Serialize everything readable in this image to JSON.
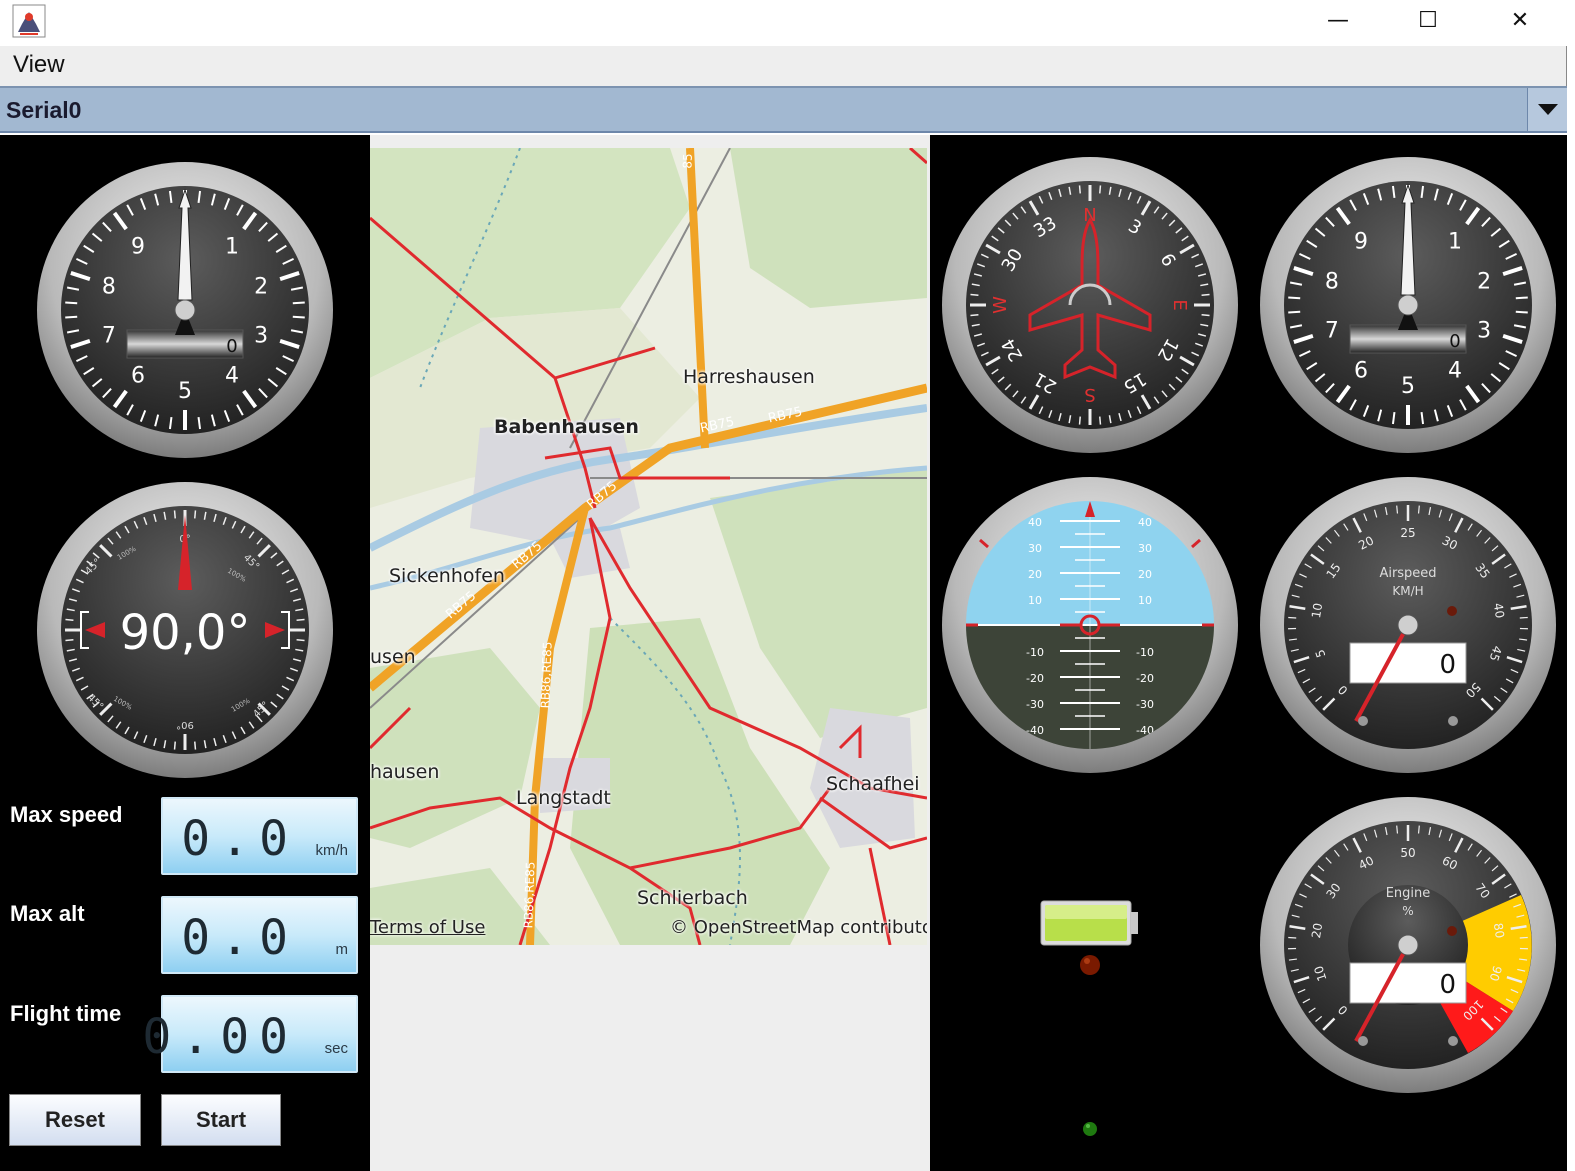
{
  "window": {
    "minimize_glyph": "—",
    "maximize_glyph": "☐",
    "close_glyph": "✕"
  },
  "menu": {
    "view_label": "View"
  },
  "port_selector": {
    "selected": "Serial0"
  },
  "gauges": {
    "altimeter_left": {
      "digits": [
        "0",
        "1",
        "2",
        "3",
        "4",
        "5",
        "6",
        "7",
        "8",
        "9"
      ],
      "counter": "0"
    },
    "altimeter_right": {
      "digits": [
        "0",
        "1",
        "2",
        "3",
        "4",
        "5",
        "6",
        "7",
        "8",
        "9"
      ],
      "counter": "0"
    },
    "heading": {
      "value_text": "90,0°",
      "top_tick": "0°",
      "bottom_tick": "90°",
      "small_labels": [
        "45°",
        "45°",
        "45°",
        "45°"
      ],
      "small_labels_pct": [
        "100%",
        "100%",
        "100%",
        "100%"
      ]
    },
    "compass": {
      "labels": [
        "N",
        "3",
        "6",
        "E",
        "12",
        "15",
        "S",
        "21",
        "24",
        "W",
        "30",
        "33"
      ],
      "accent_color": "#e03030"
    },
    "attitude": {
      "pitch_labels_up": [
        "40",
        "30",
        "20",
        "10"
      ],
      "pitch_labels_down": [
        "-10",
        "-20",
        "-30",
        "-40"
      ],
      "sky_color": "#8fd3ef",
      "ground_color": "#3d4438"
    },
    "airspeed": {
      "title": "Airspeed",
      "unit": "KM/H",
      "scale": [
        "0",
        "5",
        "10",
        "15",
        "20",
        "25",
        "30",
        "35",
        "40",
        "45",
        "50"
      ],
      "value": "0"
    },
    "engine": {
      "title": "Engine",
      "unit": "%",
      "scale": [
        "0",
        "10",
        "20",
        "30",
        "40",
        "50",
        "60",
        "70",
        "80",
        "90",
        "100"
      ],
      "value": "0",
      "warn_color": "#ffcc00",
      "danger_color": "#ff1a1a"
    }
  },
  "stats": {
    "max_speed": {
      "label": "Max speed",
      "value": "0.0",
      "unit": "km/h"
    },
    "max_alt": {
      "label": "Max alt",
      "value": "0.0",
      "unit": "m"
    },
    "flight_time": {
      "label": "Flight time",
      "value": "0.00",
      "unit": "sec"
    }
  },
  "buttons": {
    "reset": "Reset",
    "start": "Start"
  },
  "map": {
    "towns": {
      "harreshausen": "Harreshausen",
      "babenhausen": "Babenhausen",
      "sickenhofen": "Sickenhofen",
      "usen": "usen",
      "hausen": "hausen",
      "langstadt": "Langstadt",
      "schaafhei": "Schaafhei",
      "schlierbach": "Schlierbach"
    },
    "road_labels": {
      "rb75_a": "RB75",
      "rb75_b": "RB75",
      "rb75_c": "RB75",
      "rb75_d": "RB75",
      "rb75_e": "RB75",
      "rb86_a": "RB86,RE85",
      "rb86_b": "RB86,RE85",
      "re85": "85"
    },
    "terms": "Terms of Use",
    "attribution": "© OpenStreetMap contributors"
  },
  "battery": {
    "fill_color": "#b8df4a"
  },
  "leds": {
    "top_color": "#7a1a00",
    "bottom_color": "#1f7a10"
  }
}
